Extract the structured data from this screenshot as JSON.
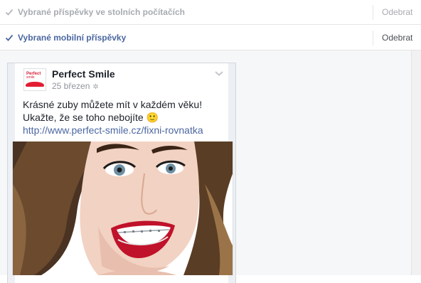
{
  "settings": {
    "rows": [
      {
        "label": "Vybrané příspěvky ve stolních počítačích",
        "action": "Odebrat",
        "state": "disabled"
      },
      {
        "label": "Vybrané mobilní příspěvky",
        "action": "Odebrat",
        "state": "active"
      }
    ]
  },
  "post": {
    "page_name": "Perfect Smile",
    "date": "25 březen",
    "date_icon": "globe-icon",
    "text_line1": "Krásné zuby můžete mít v každém věku!",
    "text_line2": "Ukažte, že se toho nebojíte",
    "emoji": "🙂",
    "link": "http://www.perfect-smile.cz/fixni-rovnatka",
    "logo_text_1": "Perfect",
    "logo_text_2": "smile",
    "menu_icon": "chevron-down-icon",
    "image": "smiling-woman-with-braces"
  },
  "colors": {
    "link": "#4b67a1",
    "muted": "#a7abb1",
    "brand": "#e21e32"
  }
}
